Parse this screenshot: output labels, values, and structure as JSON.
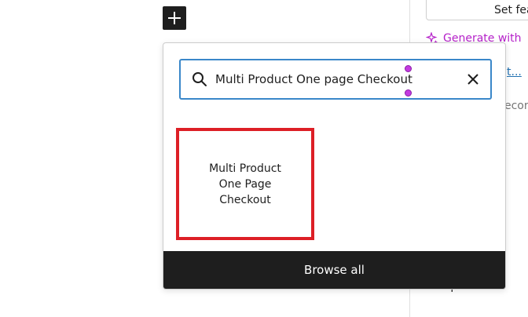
{
  "toolbar": {
    "add_block_icon": "plus-icon"
  },
  "sidebar": {
    "set_featured_label": "Set fea",
    "generate_label": "Generate with",
    "generate_icon": "sparkle-icon",
    "link_text": "t...",
    "partial_text": "ecor",
    "template_label": "Template"
  },
  "inserter": {
    "search": {
      "value": "Multi Product One page Checkout",
      "search_icon": "search-icon",
      "clear_icon": "close-icon"
    },
    "results": [
      {
        "label": "Multi Product One Page Checkout"
      }
    ],
    "browse_all_label": "Browse all"
  },
  "colors": {
    "accent": "#3a87c9",
    "highlight_border": "#dd1f26",
    "dark": "#1e1e1e",
    "ai": "#b521c9"
  }
}
